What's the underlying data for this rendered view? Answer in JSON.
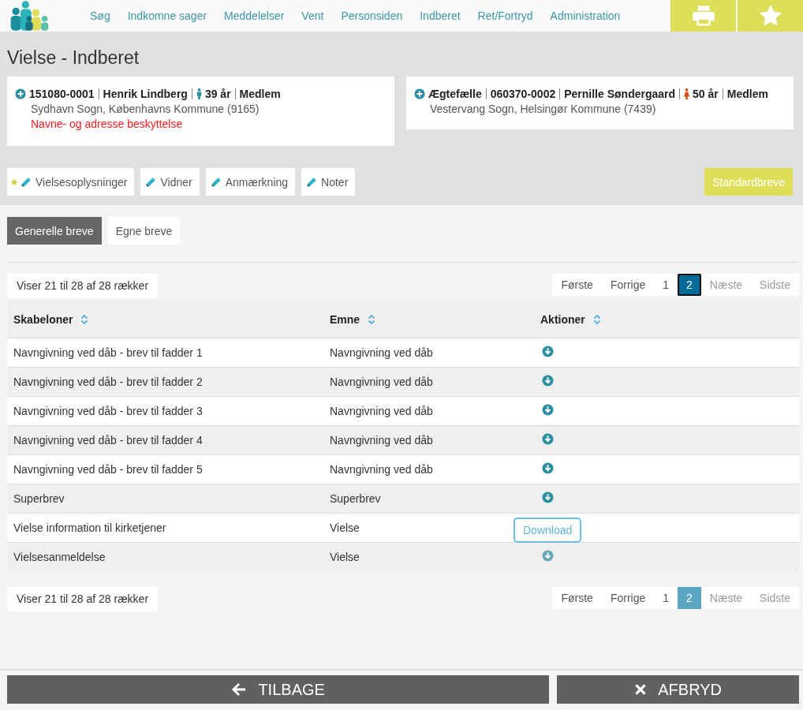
{
  "nav": {
    "items": [
      "Søg",
      "Indkomne sager",
      "Meddelelser",
      "Vent",
      "Personsiden",
      "Indberet",
      "Ret/Fortryd",
      "Administration"
    ]
  },
  "page_title": "Vielse - Indberet",
  "persons": [
    {
      "cpr": "151080-0001",
      "name": "Henrik Lindberg",
      "kind": "male",
      "age": "39 år",
      "status": "Medlem",
      "address": "Sydhavn Sogn, Københavns Kommune (9165)",
      "warning": "Navne- og adresse beskyttelse"
    },
    {
      "role": "Ægtefælle",
      "cpr": "060370-0002",
      "name": "Pernille Søndergaard",
      "kind": "female",
      "age": "50 år",
      "status": "Medlem",
      "address": "Vestervang Sogn, Helsingør Kommune (7439)"
    }
  ],
  "edit_buttons": [
    {
      "label": "Vielsesoplysninger",
      "flagged": true
    },
    {
      "label": "Vidner",
      "flagged": false
    },
    {
      "label": "Anmærkning",
      "flagged": false
    },
    {
      "label": "Noter",
      "flagged": false
    }
  ],
  "standard_button": "Standardbreve",
  "tabs": [
    {
      "label": "Generelle breve",
      "selected": true
    },
    {
      "label": "Egne breve",
      "selected": false
    }
  ],
  "top_info": "Viser 21 til 28 af 28 rækker",
  "top_pager": [
    {
      "label": "Første",
      "selected": false,
      "disabled": false,
      "focused": false
    },
    {
      "label": "Forrige",
      "selected": false,
      "disabled": false,
      "focused": false
    },
    {
      "label": "1",
      "selected": false,
      "disabled": false,
      "focused": false
    },
    {
      "label": "2",
      "selected": true,
      "disabled": false,
      "focused": true
    },
    {
      "label": "Næste",
      "selected": false,
      "disabled": true,
      "focused": false
    },
    {
      "label": "Sidste",
      "selected": false,
      "disabled": true,
      "focused": false
    }
  ],
  "table": {
    "columns": [
      "Skabeloner",
      "Emne",
      "Aktioner"
    ],
    "rows": [
      {
        "template": "Navngivning ved dåb - brev til fadder 1",
        "subject": "Navngivning ved dåb",
        "tooltip": null
      },
      {
        "template": "Navngivning ved dåb - brev til fadder 2",
        "subject": "Navngivning ved dåb",
        "tooltip": null
      },
      {
        "template": "Navngivning ved dåb - brev til fadder 3",
        "subject": "Navngivning ved dåb",
        "tooltip": null
      },
      {
        "template": "Navngivning ved dåb - brev til fadder 4",
        "subject": "Navngivning ved dåb",
        "tooltip": null
      },
      {
        "template": "Navngivning ved dåb - brev til fadder 5",
        "subject": "Navngivning ved dåb",
        "tooltip": null
      },
      {
        "template": "Superbrev",
        "subject": "Superbrev",
        "tooltip": null
      },
      {
        "template": "Vielse information til kirketjener",
        "subject": "Vielse",
        "tooltip": null
      },
      {
        "template": "Vielsesanmeldelse",
        "subject": "Vielse",
        "tooltip": "Download"
      }
    ]
  },
  "bottom_info": "Viser 21 til 28 af 28 rækker",
  "bottom_pager": [
    {
      "label": "Første",
      "selected": false,
      "disabled": false,
      "focused": false
    },
    {
      "label": "Forrige",
      "selected": false,
      "disabled": false,
      "focused": false
    },
    {
      "label": "1",
      "selected": false,
      "disabled": false,
      "focused": false
    },
    {
      "label": "2",
      "selected": true,
      "disabled": false,
      "focused": false
    },
    {
      "label": "Næste",
      "selected": false,
      "disabled": true,
      "focused": false
    },
    {
      "label": "Sidste",
      "selected": false,
      "disabled": true,
      "focused": false
    }
  ],
  "footer": {
    "back": "TILBAGE",
    "cancel": "AFBRYD"
  }
}
